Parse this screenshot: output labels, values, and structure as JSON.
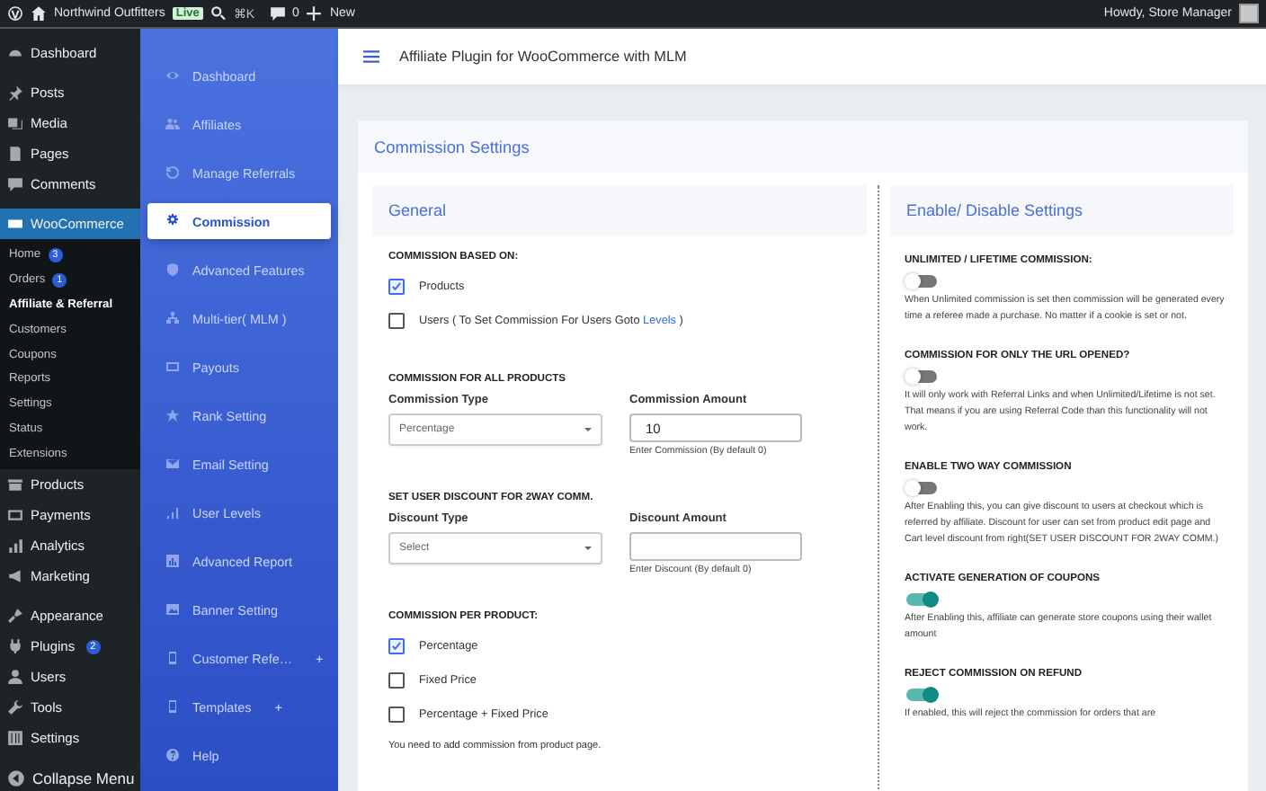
{
  "admin_bar": {
    "site_name": "Northwind Outfitters",
    "badge": "Live",
    "shortcut": "⌘K",
    "comments": "0",
    "new": "New",
    "greeting": "Howdy, Store Manager"
  },
  "wp_menu": {
    "groups": [
      [
        {
          "label": "Dashboard",
          "selected": false
        }
      ],
      [
        {
          "label": "Posts",
          "selected": false
        },
        {
          "label": "Media",
          "selected": false
        },
        {
          "label": "Pages",
          "selected": false
        },
        {
          "label": "Comments",
          "selected": false
        }
      ],
      [
        {
          "label": "WooCommerce",
          "selected": true,
          "children": [
            {
              "label": "Home",
              "count": "3",
              "selected": false
            },
            {
              "label": "Orders",
              "count": "1",
              "selected": false
            },
            {
              "label": "Affiliate & Referral",
              "selected": true
            },
            {
              "label": "Customers",
              "selected": false
            },
            {
              "label": "Coupons",
              "selected": false
            },
            {
              "label": "Reports",
              "selected": false
            },
            {
              "label": "Settings",
              "selected": false
            },
            {
              "label": "Status",
              "selected": false
            },
            {
              "label": "Extensions",
              "selected": false
            }
          ]
        },
        {
          "label": "Products",
          "selected": false
        },
        {
          "label": "Payments",
          "selected": false
        },
        {
          "label": "Analytics",
          "selected": false
        },
        {
          "label": "Marketing",
          "selected": false
        }
      ],
      [
        {
          "label": "Appearance",
          "selected": false
        },
        {
          "label": "Plugins",
          "count": "2",
          "selected": false
        },
        {
          "label": "Users",
          "selected": false
        },
        {
          "label": "Tools",
          "selected": false
        },
        {
          "label": "Settings",
          "selected": false
        }
      ]
    ],
    "collapse": "Collapse Menu"
  },
  "plugin_menu": {
    "items": [
      {
        "label": "Dashboard",
        "selected": false
      },
      {
        "label": "Affiliates",
        "selected": false
      },
      {
        "label": "Manage Referrals",
        "selected": false
      },
      {
        "label": "Commission",
        "selected": true
      },
      {
        "label": "Advanced Features",
        "selected": false
      },
      {
        "label": "Multi-tier( MLM )",
        "selected": false
      },
      {
        "label": "Payouts",
        "selected": false
      },
      {
        "label": "Rank Setting",
        "selected": false
      },
      {
        "label": "Email Setting",
        "selected": false
      },
      {
        "label": "User Levels",
        "selected": false
      },
      {
        "label": "Advanced Report",
        "selected": false
      },
      {
        "label": "Banner Setting",
        "selected": false
      },
      {
        "label": "Customer Refe…",
        "suffix": "+",
        "selected": false
      },
      {
        "label": "Templates",
        "suffix": "+",
        "selected": false
      },
      {
        "label": "Help",
        "selected": false
      }
    ]
  },
  "header": {
    "title": "Affiliate Plugin for WooCommerce with MLM"
  },
  "card": {
    "title": "Commission Settings"
  },
  "general": {
    "title": "General",
    "sections": [
      {
        "kind": "checks",
        "heading": "COMMISSION BASED ON:",
        "options": [
          {
            "label": "Products",
            "checked": true
          },
          {
            "label": "Users ( To Set Commission For Users Goto ",
            "link": "Levels",
            "label_after": " )",
            "checked": false
          }
        ]
      },
      {
        "kind": "fields",
        "heading": "COMMISSION FOR ALL PRODUCTS",
        "select": {
          "label": "Commission Type",
          "value": "Percentage"
        },
        "input": {
          "label": "Commission Amount",
          "value": "10",
          "hint": "Enter Commission (By default 0)"
        }
      },
      {
        "kind": "fields",
        "heading": "SET USER DISCOUNT FOR 2WAY COMM.",
        "select": {
          "label": "Discount Type",
          "value": "Select"
        },
        "input": {
          "label": "Discount Amount",
          "hint": "Enter Discount (By default 0)"
        }
      },
      {
        "kind": "checks",
        "heading": "COMMISSION PER PRODUCT:",
        "options": [
          {
            "label": "Percentage",
            "checked": true
          },
          {
            "label": "Fixed Price",
            "checked": false
          },
          {
            "label": "Percentage + Fixed Price",
            "checked": false
          }
        ],
        "note": "You need to add commission from product page."
      }
    ]
  },
  "settings": {
    "title": "Enable/ Disable Settings",
    "items": [
      {
        "title": "UNLIMITED / LIFETIME COMMISSION:",
        "on": false,
        "description": "When Unlimited commission is set then commission will be generated every time a referee made a purchase. No matter if a cookie is set or not."
      },
      {
        "title": "COMMISSION FOR ONLY THE URL OPENED?",
        "on": false,
        "description": "It will only work with Referral Links and when Unlimited/Lifetime is not set. That means if you are using Referral Code than this functionality will not work."
      },
      {
        "title": "ENABLE TWO WAY COMMISSION",
        "on": false,
        "description": "After Enabling this, you can give discount to users at checkout which is referred by affiliate. Discount for user can set from product edit page and Cart level discount from right(SET USER DISCOUNT FOR 2WAY COMM.)"
      },
      {
        "title": "ACTIVATE GENERATION OF COUPONS",
        "on": true,
        "description": "After Enabling this, affiliate can generate store coupons using their wallet amount"
      },
      {
        "title": "REJECT COMMISSION ON REFUND",
        "on": true,
        "description": "If enabled, this will reject the commission for orders that are"
      }
    ]
  }
}
